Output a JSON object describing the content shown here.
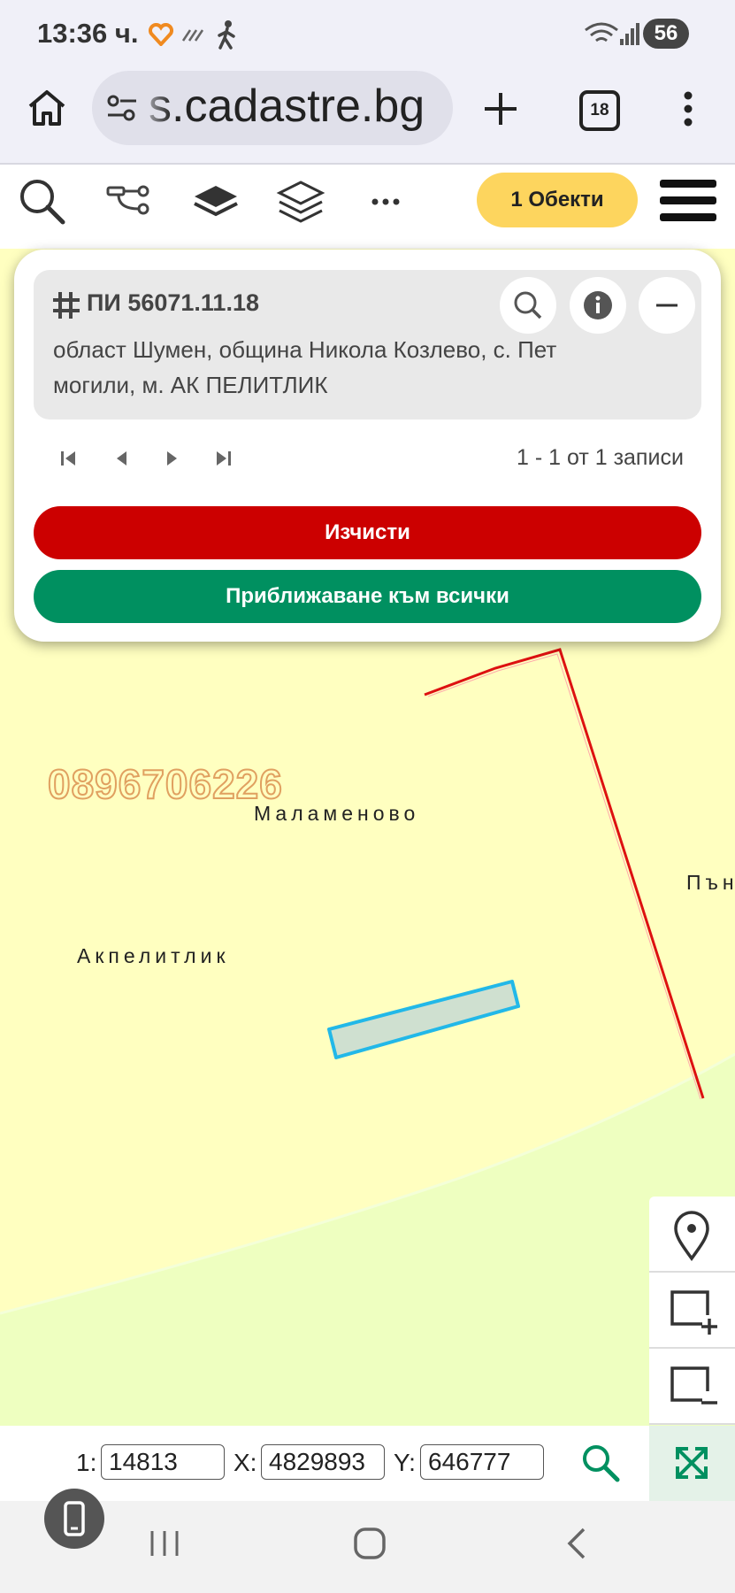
{
  "status_bar": {
    "time": "13:36 ч.",
    "battery": "56"
  },
  "browser": {
    "url": "s.cadastre.bg",
    "tab_count": "18"
  },
  "toolbar": {
    "objects_label": "1 Обекти"
  },
  "result_panel": {
    "parcel_title": "ПИ 56071.11.18",
    "address": "област Шумен, община Никола Козлево, с. Пет могили, м. АК ПЕЛИТЛИК",
    "pager_text": "1 - 1 от 1 записи",
    "clear_label": "Изчисти",
    "zoom_all_label": "Приближаване към всички"
  },
  "map": {
    "labels": {
      "phone": "0896706226",
      "malamenovo": "Маламеново",
      "akpelitlik": "Акпелитлик",
      "partial_right": "Пън"
    }
  },
  "coords": {
    "scale_label": "1:",
    "scale_value": "14813",
    "x_label": "X:",
    "x_value": "4829893",
    "y_label": "Y:",
    "y_value": "646777"
  },
  "colors": {
    "accent_yellow": "#fdd55e",
    "clear_red": "#cc0000",
    "zoom_green": "#009060",
    "map_bg": "#ffffc0",
    "parcel_outline": "#22b8e8",
    "boundary_red": "#dd1111"
  }
}
